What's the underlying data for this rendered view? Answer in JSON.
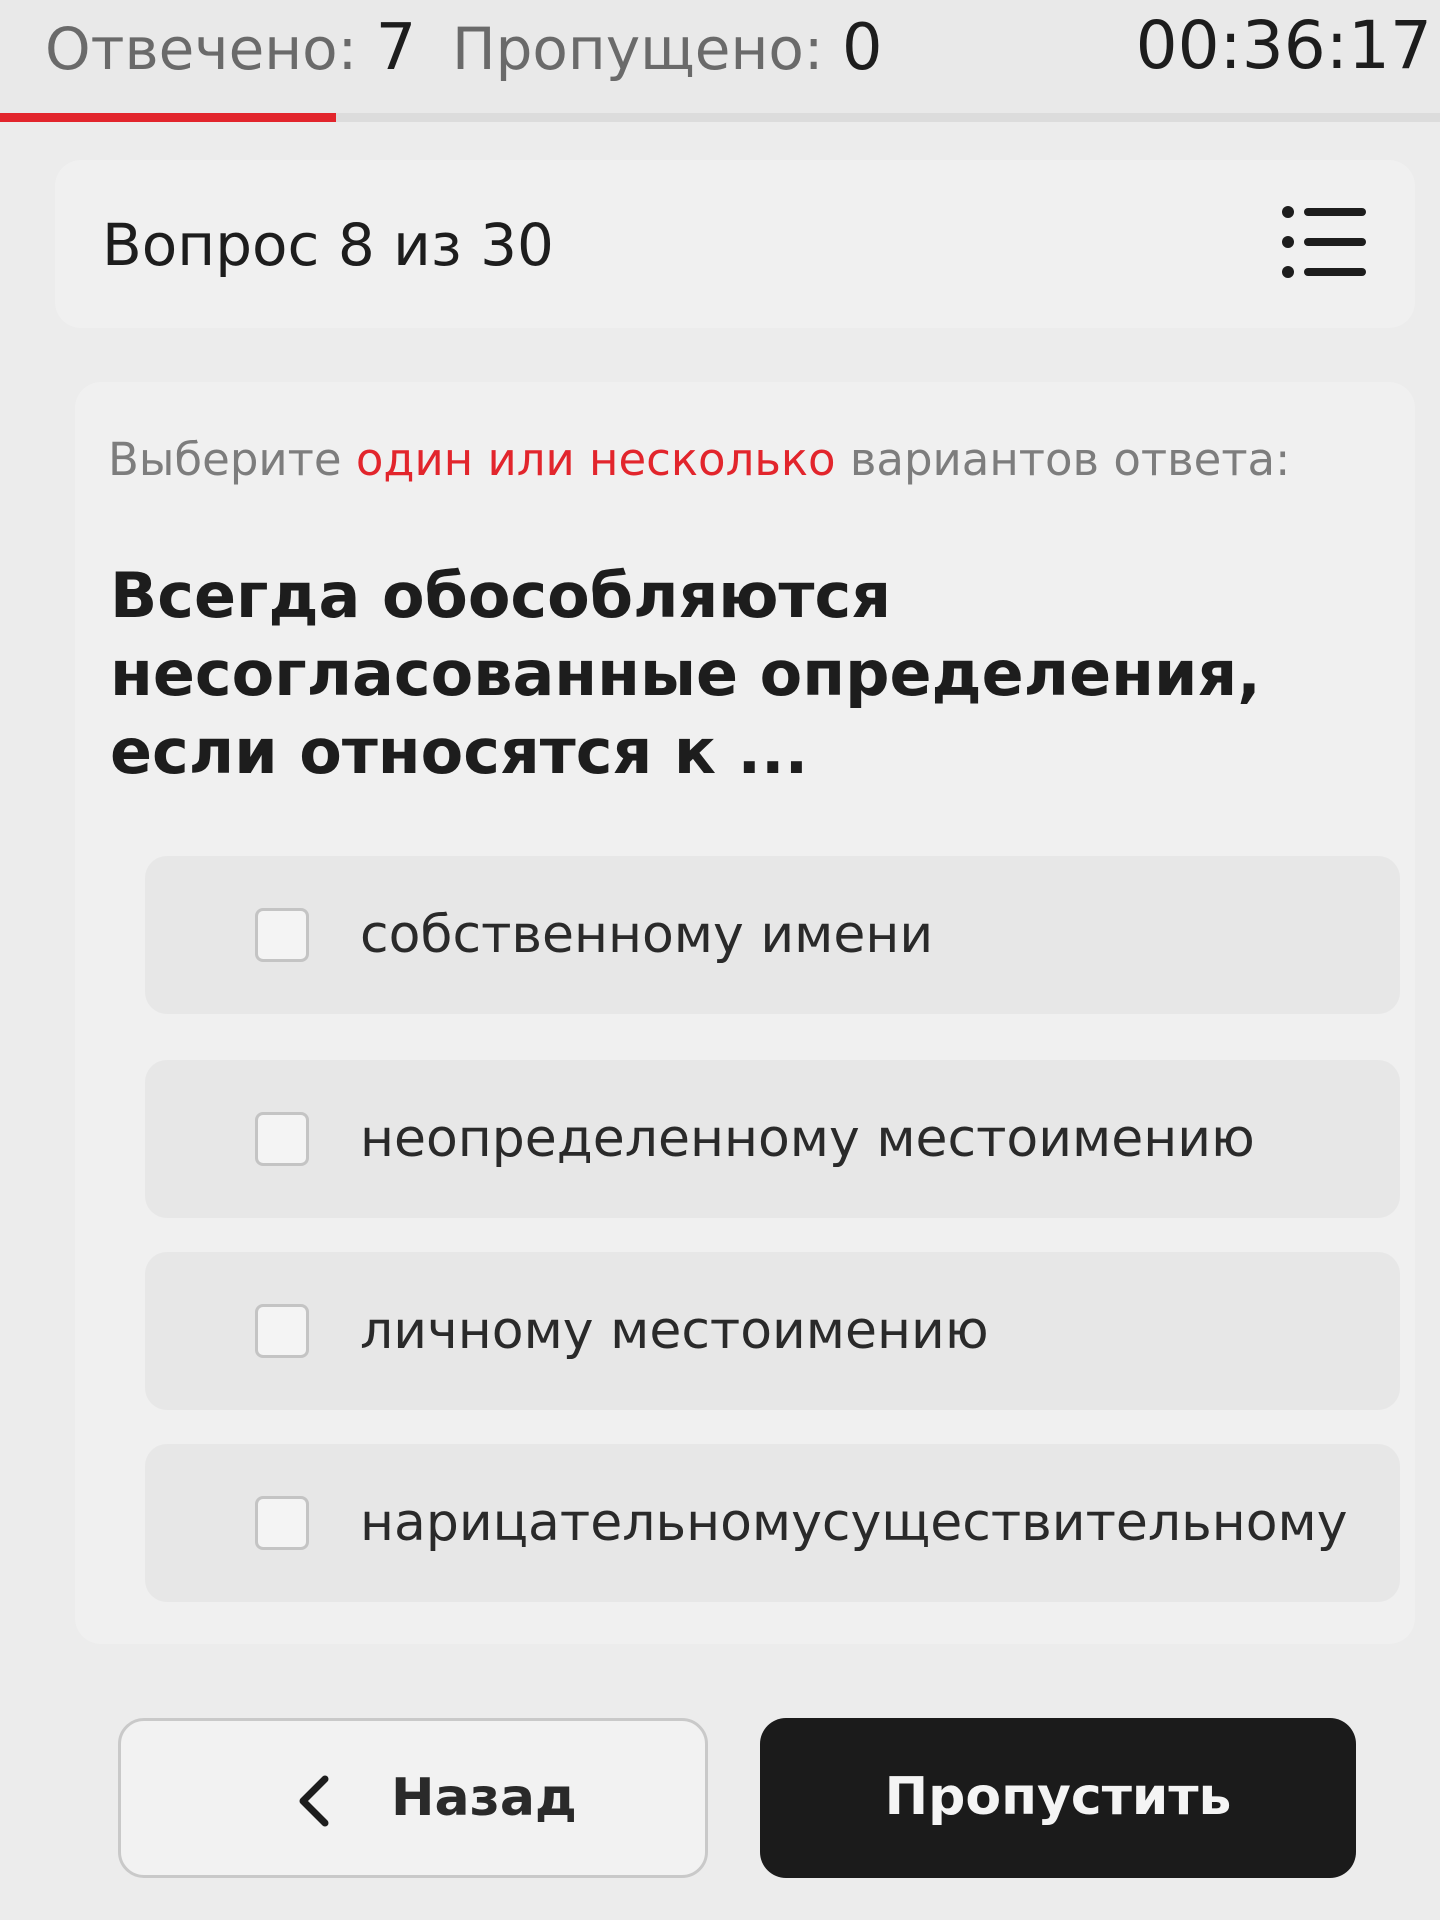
{
  "stats": {
    "answered_label": "Отвечено:",
    "answered_value": "7",
    "skipped_label": "Пропущено:",
    "skipped_value": "0",
    "timer": "00:36:17",
    "progress_fraction": 0.233
  },
  "header": {
    "question_counter": "Вопрос 8 из 30",
    "list_icon": "list-icon"
  },
  "instruction": {
    "before": "Выберите ",
    "accent": "один или несколько",
    "after": " вариантов ответа:"
  },
  "question": {
    "text": "Всегда обособляются несогласованные определения, если относятся к ..."
  },
  "options": [
    {
      "label": "собственному имени",
      "checked": false
    },
    {
      "label": "неопределенному местоимению",
      "checked": false
    },
    {
      "label": "личному местоимению",
      "checked": false
    },
    {
      "label": "нарицательномусуществительному",
      "checked": false
    }
  ],
  "footer": {
    "back_label": "Назад",
    "back_icon": "chevron-left-icon",
    "skip_label": "Пропустить"
  },
  "colors": {
    "accent": "#e2252c",
    "dark_button": "#1b1b1b"
  }
}
